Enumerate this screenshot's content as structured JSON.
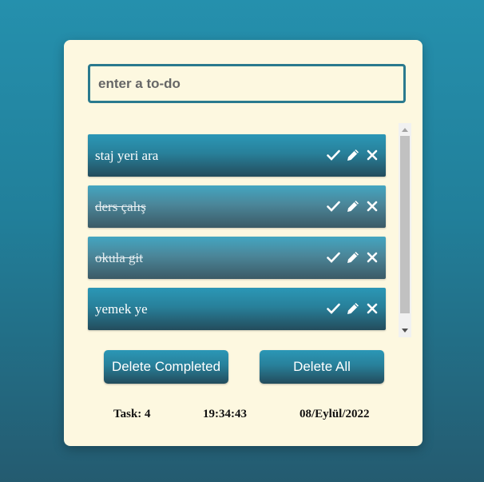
{
  "input": {
    "placeholder": "enter a to-do"
  },
  "todos": [
    {
      "text": "staj yeri ara",
      "completed": false
    },
    {
      "text": "ders çalış",
      "completed": true
    },
    {
      "text": "okula git",
      "completed": true
    },
    {
      "text": "yemek ye",
      "completed": false
    }
  ],
  "buttons": {
    "delete_completed": "Delete Completed",
    "delete_all": "Delete All"
  },
  "footer": {
    "task_count": "Task: 4",
    "time": "19:34:43",
    "date": "08/Eylül/2022"
  },
  "icons": {
    "complete": "check-icon",
    "edit": "pencil-icon",
    "delete": "close-icon"
  },
  "colors": {
    "accent": "#2a7a8e",
    "card": "#fdf8e0"
  }
}
